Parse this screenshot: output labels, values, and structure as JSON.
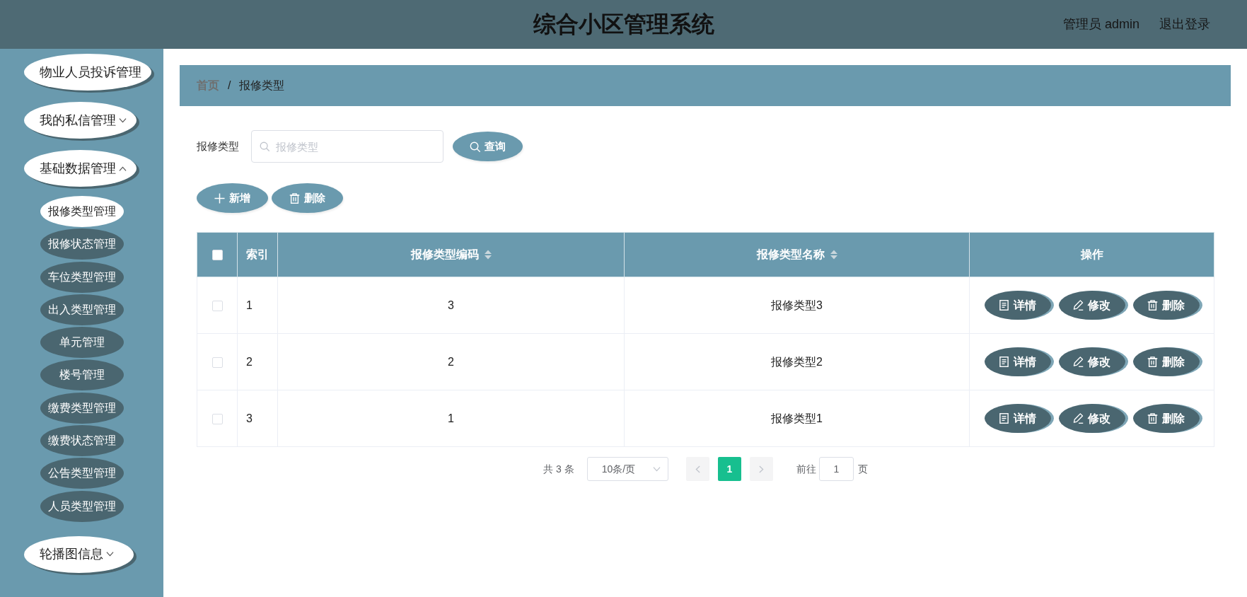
{
  "header": {
    "title": "综合小区管理系统",
    "user_label": "管理员 admin",
    "logout": "退出登录"
  },
  "sidebar": {
    "items": [
      {
        "kind": "link",
        "label": "物业人员投诉管理"
      },
      {
        "kind": "submenu",
        "label": "我的私信管理",
        "expanded": false
      },
      {
        "kind": "submenu",
        "label": "基础数据管理",
        "expanded": true,
        "children": [
          {
            "label": "报修类型管理",
            "selected": true
          },
          {
            "label": "报修状态管理",
            "selected": false
          },
          {
            "label": "车位类型管理",
            "selected": false
          },
          {
            "label": "出入类型管理",
            "selected": false
          },
          {
            "label": "单元管理",
            "selected": false
          },
          {
            "label": "楼号管理",
            "selected": false
          },
          {
            "label": "缴费类型管理",
            "selected": false
          },
          {
            "label": "缴费状态管理",
            "selected": false
          },
          {
            "label": "公告类型管理",
            "selected": false
          },
          {
            "label": "人员类型管理",
            "selected": false
          }
        ]
      },
      {
        "kind": "submenu",
        "label": "轮播图信息",
        "expanded": false
      }
    ]
  },
  "breadcrumb": {
    "separator": "/",
    "items": [
      {
        "label": "首页"
      },
      {
        "label": "报修类型"
      }
    ]
  },
  "search": {
    "label": "报修类型",
    "placeholder": "报修类型",
    "button": "查询"
  },
  "toolbar": [
    {
      "kind": "add",
      "label": "新增"
    },
    {
      "kind": "delete",
      "label": "删除"
    }
  ],
  "table": {
    "select_all": {
      "checked": false
    },
    "columns": [
      {
        "label": "索引",
        "sortable": false
      },
      {
        "label": "报修类型编码",
        "sortable": true
      },
      {
        "label": "报修类型名称",
        "sortable": true
      },
      {
        "label": "操作",
        "sortable": false
      }
    ],
    "rows": [
      {
        "selected": false,
        "cells": [
          "1",
          "3",
          "报修类型3"
        ],
        "actions": [
          {
            "kind": "detail",
            "label": "详情"
          },
          {
            "kind": "edit",
            "label": "修改"
          },
          {
            "kind": "delete",
            "label": "删除"
          }
        ]
      },
      {
        "selected": false,
        "cells": [
          "2",
          "2",
          "报修类型2"
        ],
        "actions": [
          {
            "kind": "detail",
            "label": "详情"
          },
          {
            "kind": "edit",
            "label": "修改"
          },
          {
            "kind": "delete",
            "label": "删除"
          }
        ]
      },
      {
        "selected": false,
        "cells": [
          "3",
          "1",
          "报修类型1"
        ],
        "actions": [
          {
            "kind": "detail",
            "label": "详情"
          },
          {
            "kind": "edit",
            "label": "修改"
          },
          {
            "kind": "delete",
            "label": "删除"
          }
        ]
      }
    ]
  },
  "pagination": {
    "total": "共 3 条",
    "page_size": "10条/页",
    "prev_disabled": true,
    "next_disabled": true,
    "pages": [
      {
        "label": "1",
        "selected": true
      }
    ],
    "goto_label": "前往",
    "goto_value": "1",
    "goto_suffix": "页"
  }
}
